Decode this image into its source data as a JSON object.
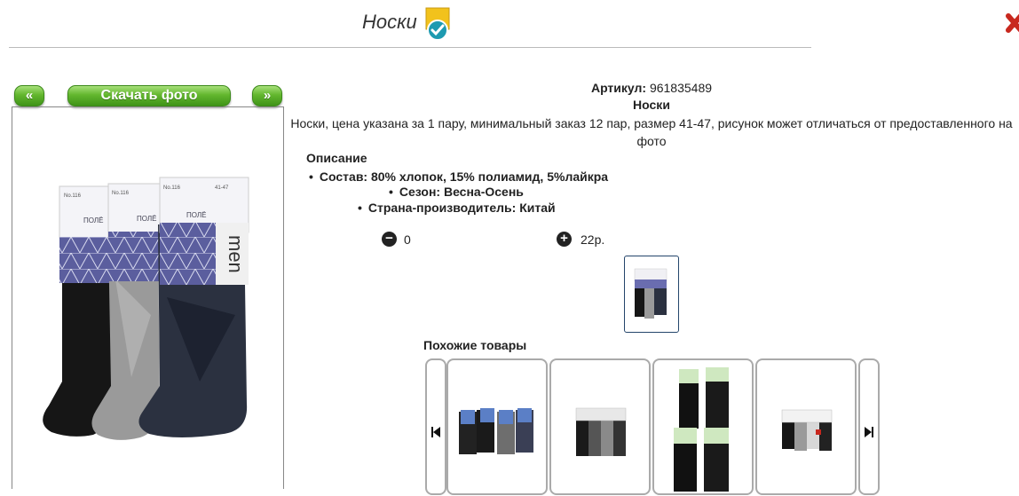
{
  "header": {
    "title": "Носки",
    "badge_icon": "check-badge-icon",
    "close_icon": "close-icon"
  },
  "photo_nav": {
    "prev_label": "«",
    "download_label": "Скачать фото",
    "next_label": "»"
  },
  "product": {
    "article_label": "Артикул:",
    "article_value": "961835489",
    "name": "Носки",
    "description": "Носки, цена указана за 1 пару, минимальный заказ 12 пар, размер 41-47, рисунок может отличаться от предоставленного на фото",
    "description_title": "Описание",
    "specs": [
      "Состав: 80% хлопок, 15% полиамид, 5%лайкра",
      "Сезон: Весна-Осень",
      "Страна-производитель: Китай"
    ]
  },
  "order": {
    "quantity": "0",
    "price": "22р.",
    "minus_icon": "minus-circle-icon",
    "plus_icon": "plus-circle-icon"
  },
  "package": {
    "brand_text": "ПОЛЁ",
    "model": "No.116",
    "size": "41-47",
    "men_text": "men"
  },
  "similar": {
    "title": "Похожие товары",
    "prev_icon": "skip-back-icon",
    "next_icon": "skip-forward-icon"
  },
  "colors": {
    "green_button": "#63b72e",
    "thumb_border": "#24456b",
    "close_red": "#c8281e"
  }
}
